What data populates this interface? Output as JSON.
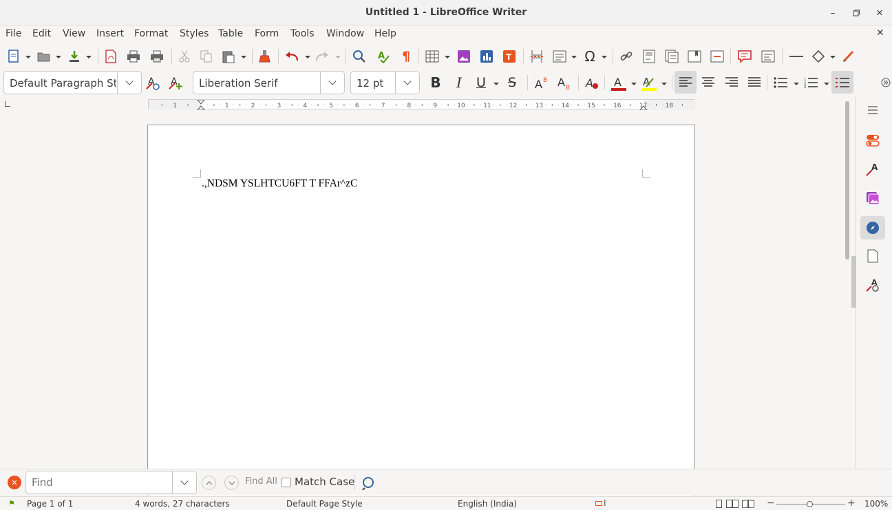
{
  "window": {
    "title": "Untitled 1 - LibreOffice Writer"
  },
  "menubar": {
    "items": [
      "File",
      "Edit",
      "View",
      "Insert",
      "Format",
      "Styles",
      "Table",
      "Form",
      "Tools",
      "Window",
      "Help"
    ]
  },
  "formatting": {
    "paragraph_style": "Default Paragraph Styl",
    "font_name": "Liberation Serif",
    "font_size": "12 pt"
  },
  "ruler": {
    "numbers": [
      "1",
      "1",
      "2",
      "3",
      "4",
      "5",
      "6",
      "7",
      "8",
      "9",
      "10",
      "11",
      "12",
      "13",
      "14",
      "15",
      "16",
      "17",
      "18"
    ]
  },
  "document": {
    "text": ".,NDSM YSLHTCU6FT T FFAr^zC"
  },
  "findbar": {
    "placeholder": "Find",
    "find_all": "Find All",
    "match_case": "Match Case"
  },
  "status": {
    "page": "Page 1 of 1",
    "words": "4 words, 27 characters",
    "page_style": "Default Page Style",
    "language": "English (India)",
    "zoom": "100%"
  },
  "colors": {
    "font_color": "#c9211e",
    "highlight": "#ffff00",
    "accent": "#3465a4"
  }
}
